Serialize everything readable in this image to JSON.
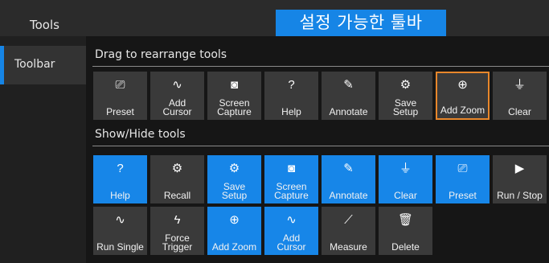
{
  "window": {
    "title": "Tools",
    "banner": "설정 가능한 툴바"
  },
  "sidebar": {
    "items": [
      {
        "label": "Toolbar"
      }
    ]
  },
  "sections": {
    "rearrange": {
      "title": "Drag to rearrange tools",
      "buttons": [
        {
          "label": "Preset",
          "icon": "preset-icon",
          "glyph": "⎚"
        },
        {
          "label": "Add\nCursor",
          "icon": "cursor-icon",
          "glyph": "∿"
        },
        {
          "label": "Screen\nCapture",
          "icon": "camera-icon",
          "glyph": "◙"
        },
        {
          "label": "Help",
          "icon": "help-icon",
          "glyph": "?"
        },
        {
          "label": "Annotate",
          "icon": "pencil-icon",
          "glyph": "✎"
        },
        {
          "label": "Save\nSetup",
          "icon": "save-setup-icon",
          "glyph": "⚙"
        },
        {
          "label": "Add Zoom",
          "icon": "zoom-icon",
          "glyph": "⊕",
          "selected": true
        },
        {
          "label": "Clear",
          "icon": "clear-icon",
          "glyph": "⏚"
        }
      ]
    },
    "showhide": {
      "title": "Show/Hide tools",
      "buttons": [
        {
          "label": "Help",
          "icon": "help-icon",
          "glyph": "?",
          "active": true
        },
        {
          "label": "Recall",
          "icon": "recall-icon",
          "glyph": "⚙",
          "active": false
        },
        {
          "label": "Save\nSetup",
          "icon": "save-setup-icon",
          "glyph": "⚙",
          "active": true
        },
        {
          "label": "Screen\nCapture",
          "icon": "camera-icon",
          "glyph": "◙",
          "active": true
        },
        {
          "label": "Annotate",
          "icon": "pencil-icon",
          "glyph": "✎",
          "active": true
        },
        {
          "label": "Clear",
          "icon": "clear-icon",
          "glyph": "⏚",
          "active": true
        },
        {
          "label": "Preset",
          "icon": "preset-icon",
          "glyph": "⎚",
          "active": true
        },
        {
          "label": "Run / Stop",
          "icon": "play-icon",
          "glyph": "▶",
          "active": false
        },
        {
          "label": "Run Single",
          "icon": "run-single-icon",
          "glyph": "∿",
          "active": false
        },
        {
          "label": "Force\nTrigger",
          "icon": "force-trigger-icon",
          "glyph": "ϟ",
          "active": false
        },
        {
          "label": "Add Zoom",
          "icon": "zoom-icon",
          "glyph": "⊕",
          "active": true
        },
        {
          "label": "Add\nCursor",
          "icon": "cursor-icon",
          "glyph": "∿",
          "active": true
        },
        {
          "label": "Measure",
          "icon": "ruler-icon",
          "glyph": "⟋",
          "active": false
        },
        {
          "label": "Delete",
          "icon": "trash-icon",
          "glyph": "🗑",
          "active": false
        }
      ]
    }
  }
}
